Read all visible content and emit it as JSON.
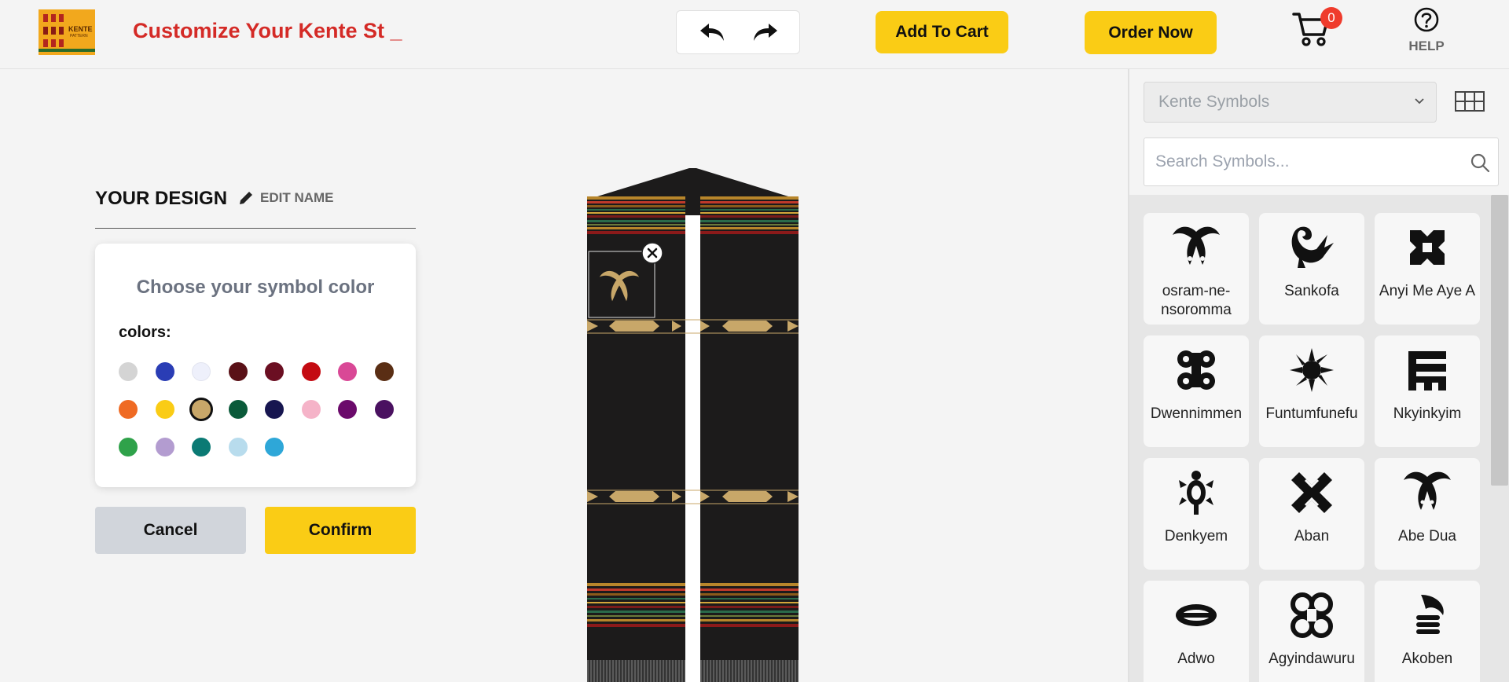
{
  "header": {
    "logo": {
      "text": "KENTE",
      "sub": "PATTERN"
    },
    "title": "Customize Your Kente St _",
    "add_to_cart": "Add To Cart",
    "order_now": "Order Now",
    "cart_count": "0",
    "help": "HELP"
  },
  "design": {
    "title": "YOUR DESIGN",
    "edit_name": "EDIT NAME"
  },
  "color_picker": {
    "title": "Choose your symbol color",
    "colors_label": "colors:",
    "colors": [
      "#d4d4d4",
      "#2a3db5",
      "#eef0fb",
      "#5a1117",
      "#6b0f22",
      "#c40b12",
      "#d94896",
      "#5a2e14",
      "#ef6a23",
      "#facc15",
      "#c8a769",
      "#0a5a3a",
      "#171650",
      "#f5b3c8",
      "#6b0a6b",
      "#4a1160",
      "#2fa24a",
      "#b39cd0",
      "#0b7a74",
      "#b8dced",
      "#2ea7d8"
    ],
    "selected_color": "#c8a769",
    "cancel": "Cancel",
    "confirm": "Confirm"
  },
  "symbols_panel": {
    "category": "Kente Symbols",
    "search_placeholder": "Search Symbols...",
    "symbols": [
      {
        "name": "osram-ne-nsoromma",
        "icon": "osram-ne-nsoromma-icon"
      },
      {
        "name": "Sankofa",
        "icon": "sankofa-icon"
      },
      {
        "name": "Anyi Me Aye A",
        "icon": "anyi-me-aye-a-icon"
      },
      {
        "name": "Dwennimmen",
        "icon": "dwennimmen-icon"
      },
      {
        "name": "Funtumfunefu",
        "icon": "funtumfunefu-icon"
      },
      {
        "name": "Nkyinkyim",
        "icon": "nkyinkyim-icon"
      },
      {
        "name": "Denkyem",
        "icon": "denkyem-icon"
      },
      {
        "name": "Aban",
        "icon": "aban-icon"
      },
      {
        "name": "Abe Dua",
        "icon": "abe-dua-icon"
      },
      {
        "name": "Adwo",
        "icon": "adwo-icon"
      },
      {
        "name": "Agyindawuru",
        "icon": "agyindawuru-icon"
      },
      {
        "name": "Akoben",
        "icon": "akoben-icon"
      }
    ]
  },
  "theme": {
    "accent": "#facc15",
    "title_red": "#d42a26",
    "stole_black": "#1c1b1b",
    "stole_gold": "#c8a769"
  }
}
